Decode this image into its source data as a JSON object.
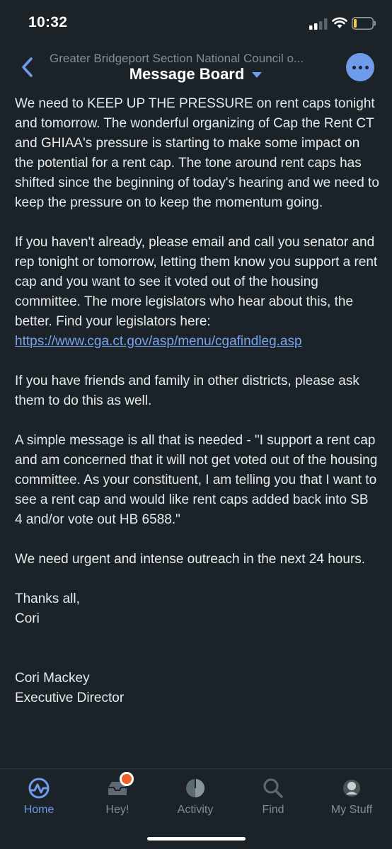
{
  "status_bar": {
    "time": "10:32"
  },
  "header": {
    "back_label": "",
    "subtitle": "Greater Bridgeport Section National Council o...",
    "title": "Message Board",
    "more_label": ""
  },
  "message": {
    "paragraphs": [
      "We need to KEEP UP THE PRESSURE on rent caps tonight and tomorrow. The wonderful organizing of Cap the Rent CT and GHIAA's pressure is starting to make some impact on the potential for a rent cap. The tone around rent caps has shifted since the beginning of today's hearing and we need to keep the pressure on to keep the momentum going.",
      "If you haven't already, please email and call you senator and rep tonight or tomorrow, letting them know you support a rent cap and you want to see it voted out of the housing committee. The more legislators who hear about this, the better. Find your legislators here:",
      "If you have friends and family in other districts, please ask them to do this as well.",
      "A simple message is all that is needed - \"I support a rent cap and am concerned that it will not get voted out of the housing committee. As your constituent, I am telling you that I want to see a rent cap and would like rent caps added back into SB 4 and/or vote out HB 6588.\"",
      "We need urgent and intense outreach in the next 24 hours."
    ],
    "link": "https://www.cga.ct.gov/asp/menu/cgafindleg.asp",
    "signoff_line1": "Thanks all,",
    "signoff_line2": "Cori",
    "signature_name": "Cori Mackey",
    "signature_title": "Executive Director"
  },
  "tabs": [
    {
      "label": "Home",
      "icon": "home-pulse-icon",
      "active": true
    },
    {
      "label": "Hey!",
      "icon": "inbox-tray-icon",
      "badge": true
    },
    {
      "label": "Activity",
      "icon": "activity-pie-icon"
    },
    {
      "label": "Find",
      "icon": "search-icon"
    },
    {
      "label": "My Stuff",
      "icon": "avatar-icon"
    }
  ],
  "colors": {
    "background": "#1b2328",
    "accent": "#6f9bed",
    "link": "#78a4ee",
    "badge": "#ef5f2c"
  }
}
